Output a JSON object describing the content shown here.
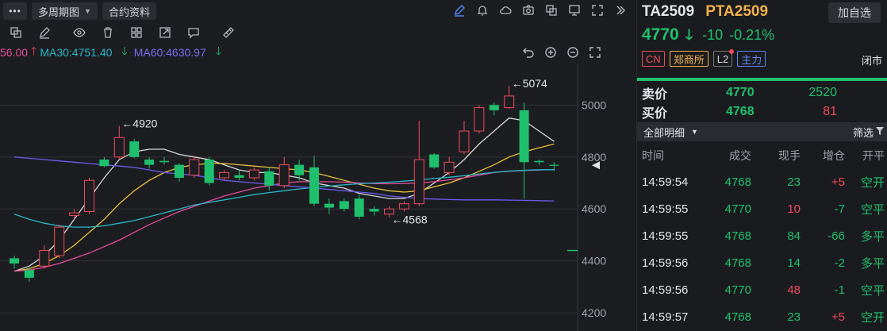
{
  "toolbar": {
    "menu_label": "•••",
    "period_label": "多周期图",
    "contract_info_label": "合约资料"
  },
  "ma": {
    "ma_partial": "56.00",
    "ma30": "MA30:4751.40",
    "ma60": "MA60:4630.97",
    "colors": {
      "ma_partial": "#e44a9a",
      "ma30": "#25b8c8",
      "ma60": "#7a6cf0",
      "arrow_up": "#f04a5a",
      "arrow_down": "#1fc06d"
    }
  },
  "chart_data": {
    "type": "candlestick",
    "y_ticks": [
      "5000",
      "4800",
      "4600",
      "4400",
      "4200"
    ],
    "ylim": [
      4130,
      5160
    ],
    "annotations": [
      {
        "label": "←5074",
        "value": 5074
      },
      {
        "label": "←4920",
        "value": 4920
      },
      {
        "label": "←4568",
        "value": 4568
      }
    ],
    "candles": [
      {
        "o": 4410,
        "c": 4390,
        "h": 4420,
        "l": 4370
      },
      {
        "o": 4365,
        "c": 4335,
        "h": 4375,
        "l": 4320
      },
      {
        "o": 4380,
        "c": 4440,
        "h": 4460,
        "l": 4370
      },
      {
        "o": 4420,
        "c": 4530,
        "h": 4540,
        "l": 4410
      },
      {
        "o": 4575,
        "c": 4585,
        "h": 4600,
        "l": 4560
      },
      {
        "o": 4590,
        "c": 4710,
        "h": 4720,
        "l": 4580
      },
      {
        "o": 4790,
        "c": 4765,
        "h": 4800,
        "l": 4760
      },
      {
        "o": 4800,
        "c": 4875,
        "h": 4920,
        "l": 4790
      },
      {
        "o": 4860,
        "c": 4800,
        "h": 4870,
        "l": 4795
      },
      {
        "o": 4790,
        "c": 4770,
        "h": 4800,
        "l": 4755
      },
      {
        "o": 4785,
        "c": 4780,
        "h": 4800,
        "l": 4770
      },
      {
        "o": 4770,
        "c": 4720,
        "h": 4775,
        "l": 4705
      },
      {
        "o": 4730,
        "c": 4790,
        "h": 4805,
        "l": 4720
      },
      {
        "o": 4790,
        "c": 4700,
        "h": 4800,
        "l": 4690
      },
      {
        "o": 4720,
        "c": 4740,
        "h": 4750,
        "l": 4710
      },
      {
        "o": 4730,
        "c": 4720,
        "h": 4750,
        "l": 4710
      },
      {
        "o": 4720,
        "c": 4750,
        "h": 4760,
        "l": 4710
      },
      {
        "o": 4745,
        "c": 4690,
        "h": 4760,
        "l": 4670
      },
      {
        "o": 4690,
        "c": 4770,
        "h": 4800,
        "l": 4680
      },
      {
        "o": 4770,
        "c": 4730,
        "h": 4790,
        "l": 4710
      },
      {
        "o": 4760,
        "c": 4620,
        "h": 4805,
        "l": 4610
      },
      {
        "o": 4620,
        "c": 4605,
        "h": 4640,
        "l": 4580
      },
      {
        "o": 4630,
        "c": 4600,
        "h": 4640,
        "l": 4590
      },
      {
        "o": 4640,
        "c": 4570,
        "h": 4655,
        "l": 4560
      },
      {
        "o": 4600,
        "c": 4590,
        "h": 4610,
        "l": 4575
      },
      {
        "o": 4580,
        "c": 4600,
        "h": 4610,
        "l": 4568
      },
      {
        "o": 4600,
        "c": 4620,
        "h": 4630,
        "l": 4590
      },
      {
        "o": 4620,
        "c": 4790,
        "h": 4940,
        "l": 4610
      },
      {
        "o": 4810,
        "c": 4760,
        "h": 4815,
        "l": 4755
      },
      {
        "o": 4740,
        "c": 4780,
        "h": 4800,
        "l": 4730
      },
      {
        "o": 4820,
        "c": 4900,
        "h": 4940,
        "l": 4810
      },
      {
        "o": 4900,
        "c": 4990,
        "h": 5000,
        "l": 4890
      },
      {
        "o": 5000,
        "c": 4980,
        "h": 5010,
        "l": 4960
      },
      {
        "o": 4990,
        "c": 5035,
        "h": 5074,
        "l": 4985
      },
      {
        "o": 4980,
        "c": 4780,
        "h": 5010,
        "l": 4640
      },
      {
        "o": 4785,
        "c": 4780,
        "h": 4790,
        "l": 4770
      },
      {
        "o": 4770,
        "c": 4768,
        "h": 4780,
        "l": 4745
      }
    ],
    "series": [
      {
        "color": "#d8d8d8",
        "values": [
          4360,
          4380,
          4420,
          4480,
          4560,
          4640,
          4720,
          4790,
          4820,
          4830,
          4830,
          4810,
          4800,
          4790,
          4770,
          4750,
          4740,
          4740,
          4730,
          4720,
          4700,
          4690,
          4680,
          4660,
          4650,
          4640,
          4640,
          4660,
          4700,
          4740,
          4790,
          4850,
          4900,
          4950,
          4940,
          4900,
          4860
        ]
      },
      {
        "color": "#e9c23a",
        "values": [
          4360,
          4370,
          4390,
          4420,
          4460,
          4510,
          4560,
          4620,
          4670,
          4710,
          4740,
          4760,
          4770,
          4775,
          4775,
          4770,
          4765,
          4760,
          4755,
          4750,
          4740,
          4725,
          4710,
          4695,
          4680,
          4670,
          4665,
          4670,
          4685,
          4700,
          4720,
          4745,
          4770,
          4800,
          4820,
          4835,
          4850
        ]
      },
      {
        "color": "#e44a9a",
        "values": [
          4360,
          4365,
          4375,
          4390,
          4410,
          4430,
          4455,
          4480,
          4510,
          4540,
          4565,
          4590,
          4610,
          4630,
          4650,
          4665,
          4680,
          4690,
          4700,
          4705,
          4705,
          4705,
          4703,
          4700,
          4698,
          4697,
          4698,
          4700,
          4705,
          4712,
          4720,
          4730,
          4740,
          4745,
          4748,
          4750,
          4752
        ]
      },
      {
        "color": "#25b8c8",
        "values": [
          4580,
          4560,
          4545,
          4535,
          4530,
          4530,
          4535,
          4545,
          4555,
          4570,
          4585,
          4600,
          4615,
          4625,
          4635,
          4645,
          4655,
          4663,
          4670,
          4677,
          4683,
          4688,
          4693,
          4697,
          4700,
          4703,
          4707,
          4712,
          4717,
          4722,
          4728,
          4735,
          4741,
          4746,
          4749,
          4751,
          4751
        ]
      },
      {
        "color": "#6d5cf0",
        "values": [
          4800,
          4795,
          4790,
          4785,
          4780,
          4775,
          4770,
          4765,
          4760,
          4750,
          4740,
          4735,
          4730,
          4720,
          4710,
          4705,
          4700,
          4695,
          4690,
          4685,
          4680,
          4675,
          4670,
          4665,
          4660,
          4650,
          4645,
          4640,
          4638,
          4636,
          4635,
          4635,
          4635,
          4634,
          4633,
          4632,
          4631
        ]
      }
    ]
  },
  "quote": {
    "code": "TA2509",
    "name": "PTA2509",
    "fav_label": "加自选",
    "last": "4770",
    "change": "-10",
    "change_pct": "-0.21%",
    "tags": [
      "CN",
      "郑商所",
      "L2",
      "主力"
    ],
    "status": "闭市",
    "ask_label": "卖价",
    "ask_price": "4770",
    "ask_vol": "2520",
    "bid_label": "买价",
    "bid_price": "4768",
    "bid_vol": "81",
    "detail_tab": "全部明细",
    "filter_label": "筛选",
    "columns": [
      "时间",
      "成交",
      "现手",
      "增仓",
      "开平"
    ],
    "trades": [
      {
        "time": "14:59:54",
        "price": "4768",
        "vol": "23",
        "oi": "+5",
        "type": "空开",
        "vol_color": "green",
        "oi_color": "red",
        "type_color": "green"
      },
      {
        "time": "14:59:55",
        "price": "4770",
        "vol": "10",
        "oi": "-7",
        "type": "空平",
        "vol_color": "red",
        "oi_color": "green",
        "type_color": "green"
      },
      {
        "time": "14:59:55",
        "price": "4768",
        "vol": "84",
        "oi": "-66",
        "type": "多平",
        "vol_color": "green",
        "oi_color": "green",
        "type_color": "green"
      },
      {
        "time": "14:59:56",
        "price": "4768",
        "vol": "14",
        "oi": "-2",
        "type": "多平",
        "vol_color": "green",
        "oi_color": "green",
        "type_color": "green"
      },
      {
        "time": "14:59:56",
        "price": "4770",
        "vol": "48",
        "oi": "-1",
        "type": "空平",
        "vol_color": "red",
        "oi_color": "green",
        "type_color": "green"
      },
      {
        "time": "14:59:57",
        "price": "4768",
        "vol": "23",
        "oi": "+5",
        "type": "空开",
        "vol_color": "green",
        "oi_color": "red",
        "type_color": "green"
      }
    ]
  }
}
